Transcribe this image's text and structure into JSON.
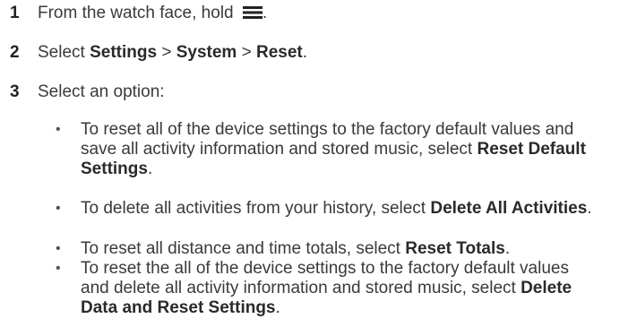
{
  "steps": [
    {
      "number": "1",
      "text": "From the watch face, hold ",
      "icon": "menu-icon",
      "after_icon": "."
    },
    {
      "number": "2",
      "prefix": "Select ",
      "path": [
        "Settings",
        "System",
        "Reset"
      ],
      "separator": " > ",
      "suffix": "."
    },
    {
      "number": "3",
      "text": "Select an option:"
    }
  ],
  "bullet_marker": "•",
  "options": [
    {
      "pre": "To reset all of the device settings to the factory default values and save all activity information and stored music, select ",
      "bold": "Reset Default Settings",
      "post": "."
    },
    {
      "pre": "To delete all activities from your history, select ",
      "bold": "Delete All Activities",
      "post": "."
    },
    {
      "pre": "To reset all distance and time totals, select ",
      "bold": "Reset Totals",
      "post": "."
    },
    {
      "pre": "To reset the all of the device settings to the factory default values and delete all activity information and stored music, select ",
      "bold": "Delete Data and Reset Settings",
      "post": "."
    }
  ]
}
